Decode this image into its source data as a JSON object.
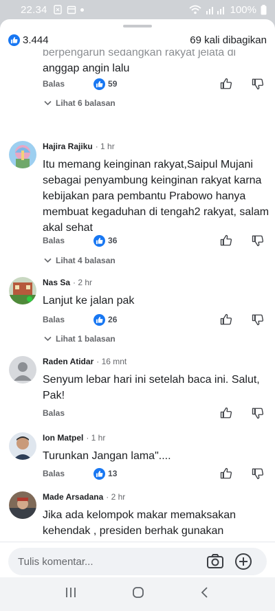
{
  "status_bar": {
    "time": "22.34",
    "battery": "100%"
  },
  "header": {
    "like_count": "3.444",
    "shares": "69 kali dibagikan"
  },
  "cut_text": [
    "berpengaruh sedangkan rakyat jelata di",
    "anggap angin lalu"
  ],
  "first_actions": {
    "reply": "Balas",
    "likes": "59",
    "replies": "Lihat 6 balasan"
  },
  "comments": [
    {
      "name": "Hajira Rajiku",
      "time": "· 1 hr",
      "text": "Itu memang keinginan rakyat,Saipul Mujani sebagai penyambung keinginan rakyat karna kebijakan para pembantu Prabowo hanya membuat kegaduhan di tengah2 rakyat, salam akal sehat",
      "reply": "Balas",
      "likes": "36",
      "replies": "Lihat 4 balasan"
    },
    {
      "name": "Nas Sa",
      "time": "· 2 hr",
      "text": "Lanjut ke jalan pak",
      "reply": "Balas",
      "likes": "26",
      "replies": "Lihat 1 balasan"
    },
    {
      "name": "Raden Atidar",
      "time": "· 16 mnt",
      "text": "Senyum lebar hari ini setelah baca ini. Salut, Pak!",
      "reply": "Balas"
    },
    {
      "name": "Ion Matpel",
      "time": "· 1 hr",
      "text": "Turunkan Jangan lama\"....",
      "reply": "Balas",
      "likes": "13"
    },
    {
      "name": "Made Arsadana",
      "time": "· 2 hr",
      "text": "Jika ada kelompok makar memaksakan kehendak , presiden berhak gunakan kekuatan kekuasaan ! Kelompok manapun ingin makar silahkan akan berhadapan"
    }
  ],
  "composer": {
    "placeholder": "Tulis komentar..."
  },
  "icons": [
    "like-icon",
    "thumbs-up-icon",
    "thumbs-down-icon",
    "chevron-down-icon",
    "camera-icon",
    "plus-icon",
    "wifi-icon",
    "signal-icon",
    "battery-icon",
    "recents-icon",
    "home-icon",
    "back-icon"
  ],
  "colors": {
    "accent": "#1877f2",
    "secondary_text": "#65676b"
  }
}
